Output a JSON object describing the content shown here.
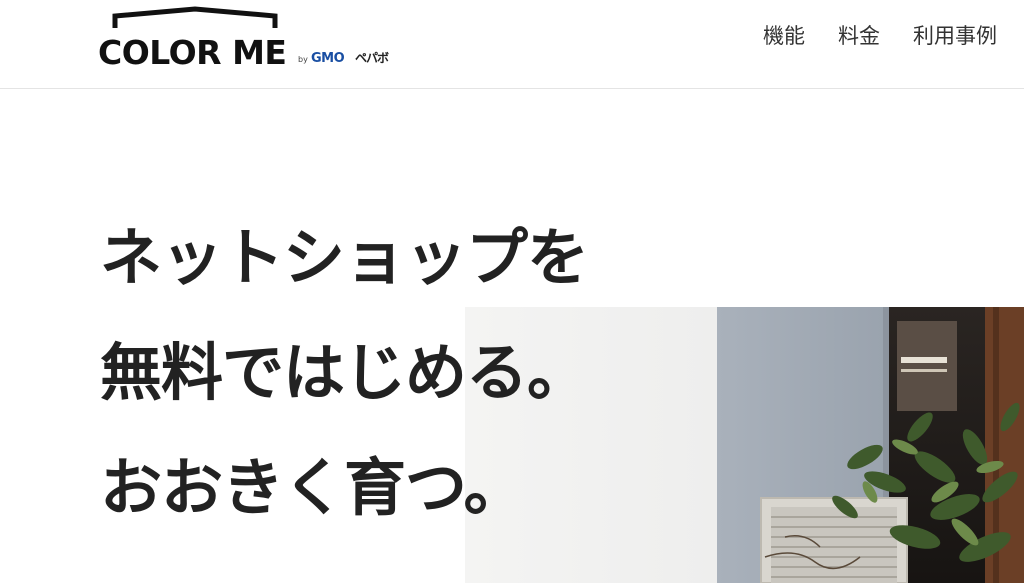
{
  "header": {
    "logo": {
      "name": "COLOR ME",
      "by": "by",
      "company": "GMO",
      "company_suffix": "ペパボ"
    },
    "nav": [
      {
        "label": "機能"
      },
      {
        "label": "料金"
      },
      {
        "label": "利用事例"
      }
    ]
  },
  "hero": {
    "headline_lines": [
      "ネットショップを",
      "無料ではじめる。",
      "おおきく育つ。"
    ]
  },
  "colors": {
    "text": "#222222",
    "nav_text": "#333333",
    "brand_blue": "#1a4fa3",
    "divider": "#e4e4e4"
  }
}
